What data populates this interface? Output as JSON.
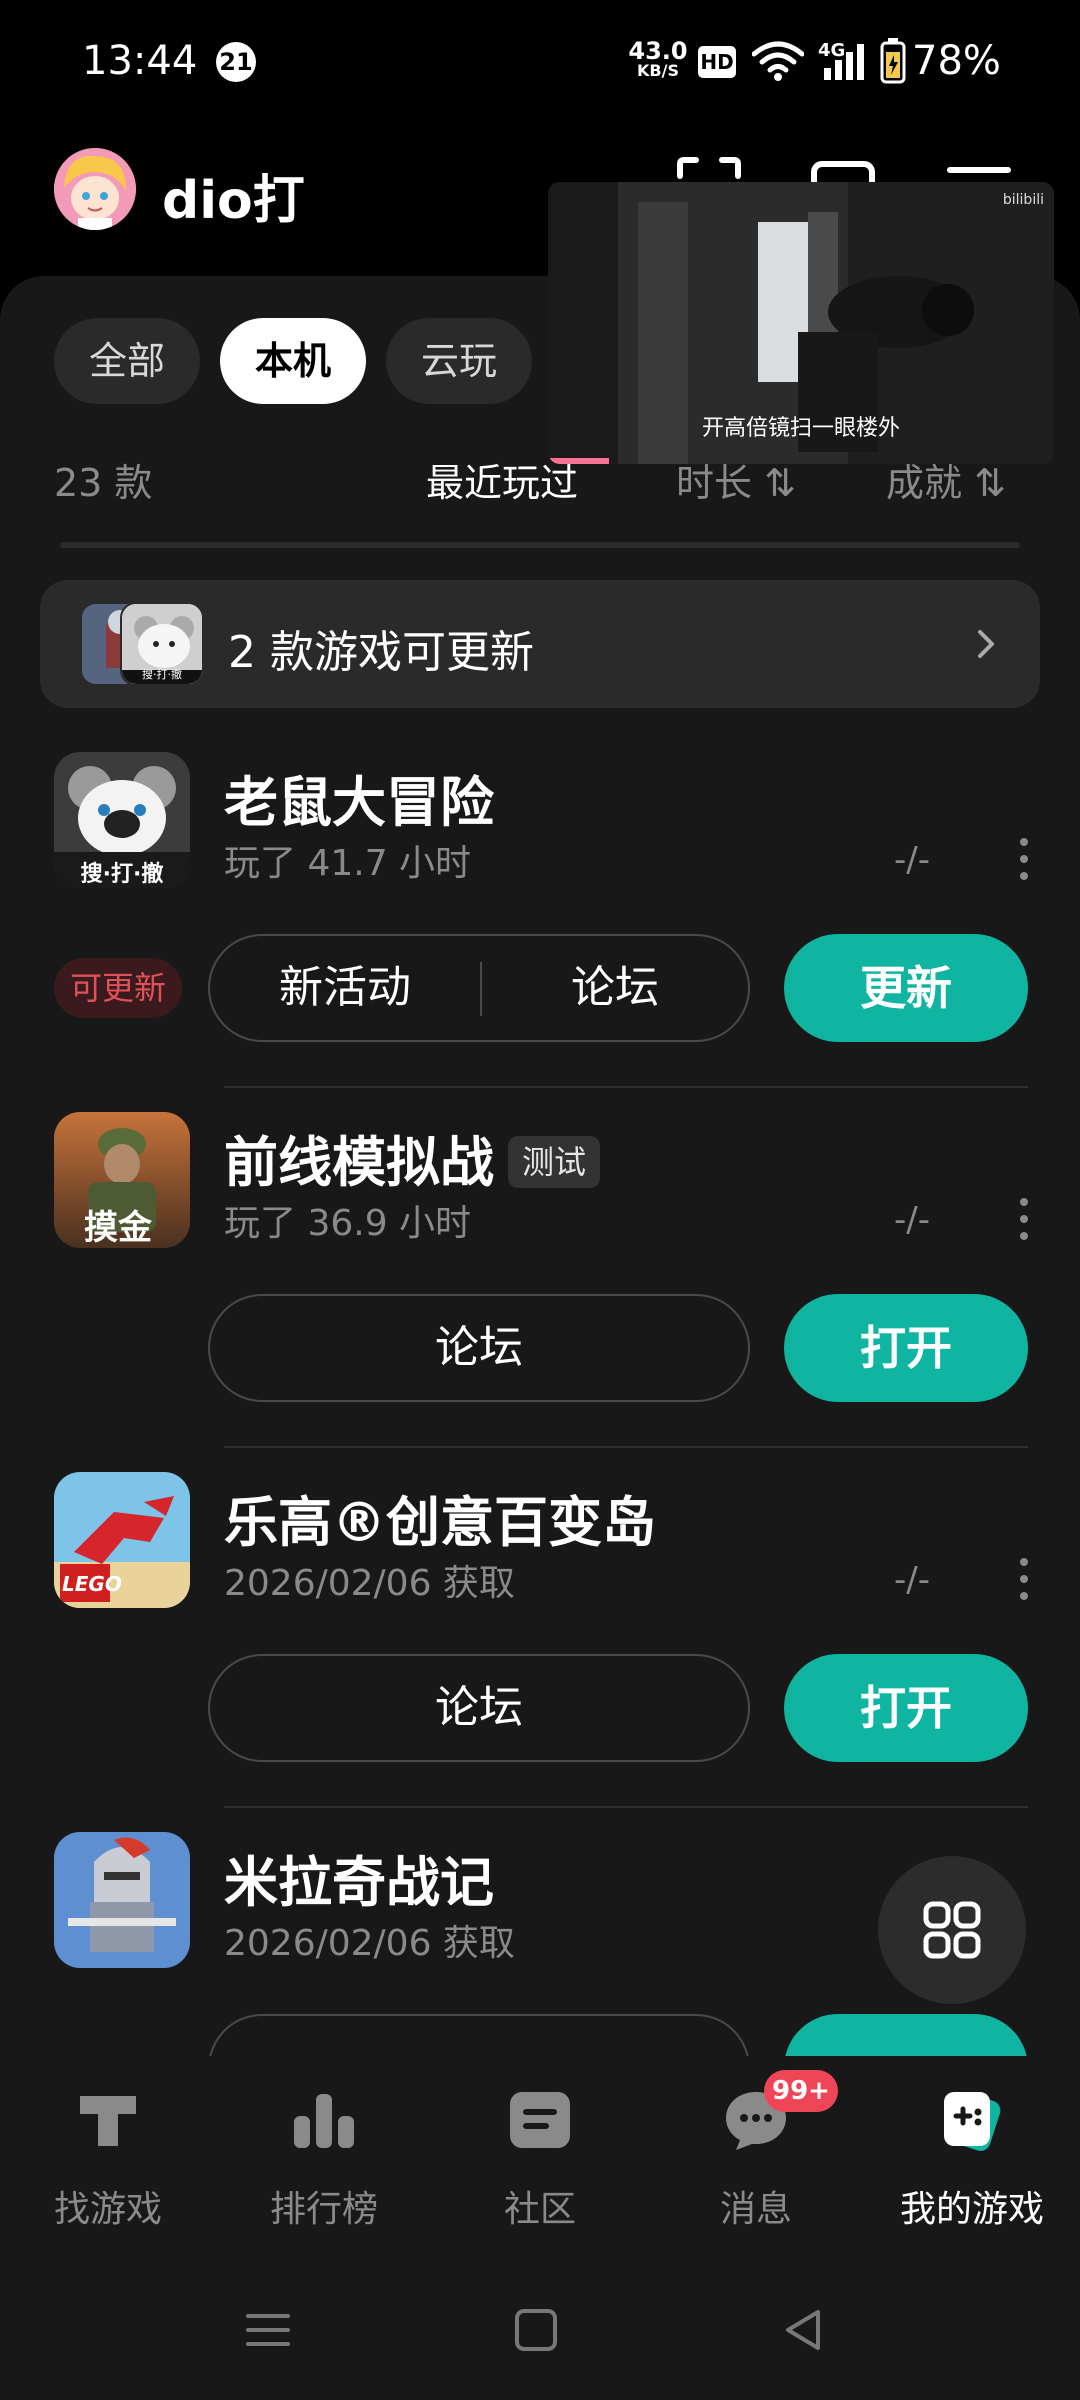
{
  "status_bar": {
    "time": "13:44",
    "notification_count": "21",
    "net_speed_value": "43.0",
    "net_speed_unit": "KB/S",
    "hd": "HD",
    "network": "4G",
    "battery": "78%"
  },
  "header": {
    "username": "dio打",
    "icons": [
      "scan-icon",
      "window-icon",
      "menu-icon"
    ]
  },
  "video": {
    "caption": "开高倍镜扫一眼楼外",
    "watermark": "bilibili",
    "progress": 0.12
  },
  "filter_tabs": [
    {
      "label": "全部",
      "active": false
    },
    {
      "label": "本机",
      "active": true
    },
    {
      "label": "云玩",
      "active": false
    }
  ],
  "list_header": {
    "count": "23 款",
    "sort": [
      {
        "label": "最近玩过",
        "active": true
      },
      {
        "label": "时长",
        "active": false
      },
      {
        "label": "成就",
        "active": false
      }
    ]
  },
  "update_banner": {
    "text": "2 款游戏可更新",
    "icon_badge_text": "搜·打·撤"
  },
  "games": [
    {
      "title": "老鼠大冒险",
      "tag": "",
      "subtitle": "玩了 41.7 小时",
      "score": "-/-",
      "icon_text": "搜·打·撤",
      "update_badge": "可更新",
      "links": [
        "新活动",
        "论坛"
      ],
      "action": "更新"
    },
    {
      "title": "前线模拟战",
      "tag": "测试",
      "subtitle": "玩了 36.9 小时",
      "score": "-/-",
      "icon_text": "摸金",
      "update_badge": "",
      "links": [
        "论坛"
      ],
      "action": "打开"
    },
    {
      "title": "乐高®创意百变岛",
      "tag": "",
      "subtitle": "2026/02/06 获取",
      "score": "-/-",
      "icon_text": "LEGO",
      "update_badge": "",
      "links": [
        "论坛"
      ],
      "action": "打开"
    },
    {
      "title": "米拉奇战记",
      "tag": "",
      "subtitle": "2026/02/06 获取",
      "score": "",
      "icon_text": "",
      "update_badge": "",
      "links": [],
      "action": ""
    }
  ],
  "bottom_nav": [
    {
      "label": "找游戏",
      "icon": "find-games-icon",
      "active": false
    },
    {
      "label": "排行榜",
      "icon": "ranking-icon",
      "active": false
    },
    {
      "label": "社区",
      "icon": "community-icon",
      "active": false
    },
    {
      "label": "消息",
      "icon": "message-icon",
      "active": false,
      "badge": "99+"
    },
    {
      "label": "我的游戏",
      "icon": "my-games-icon",
      "active": true
    }
  ],
  "colors": {
    "accent": "#0fb5a0",
    "update_red": "#e0525a",
    "badge_red": "#ef4657",
    "background": "#181818"
  }
}
